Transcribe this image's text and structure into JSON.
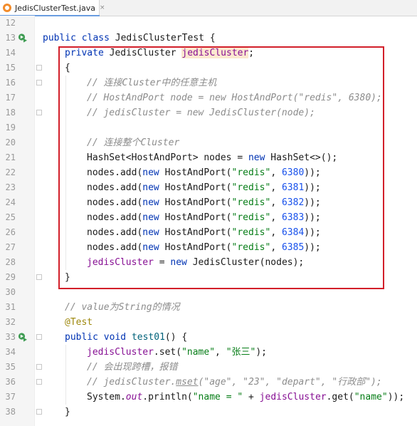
{
  "tab": {
    "title": "JedisClusterTest.java",
    "close": "×"
  },
  "lines": [
    {
      "n": "12",
      "segs": []
    },
    {
      "n": "13",
      "run": true,
      "segs": [
        {
          "t": "public ",
          "c": "kw"
        },
        {
          "t": "class ",
          "c": "kw"
        },
        {
          "t": "JedisClusterTest {",
          "c": ""
        }
      ]
    },
    {
      "n": "14",
      "indent": 1,
      "segs": [
        {
          "t": "private ",
          "c": "kw"
        },
        {
          "t": "JedisCluster ",
          "c": ""
        },
        {
          "t": "jedisCluster",
          "c": "fld hl"
        },
        {
          "t": ";",
          "c": ""
        }
      ]
    },
    {
      "n": "15",
      "indent": 1,
      "fold": true,
      "segs": [
        {
          "t": "{",
          "c": ""
        }
      ]
    },
    {
      "n": "16",
      "indent": 2,
      "fold": true,
      "segs": [
        {
          "t": "// 连接Cluster中的任意主机",
          "c": "cmt"
        }
      ]
    },
    {
      "n": "17",
      "indent": 2,
      "segs": [
        {
          "t": "// HostAndPort node = new HostAndPort(\"redis\", 6380);",
          "c": "cmt"
        }
      ]
    },
    {
      "n": "18",
      "indent": 2,
      "fold": true,
      "segs": [
        {
          "t": "// jedisCluster = new JedisCluster(node);",
          "c": "cmt"
        }
      ]
    },
    {
      "n": "19",
      "segs": []
    },
    {
      "n": "20",
      "indent": 2,
      "segs": [
        {
          "t": "// 连接整个Cluster",
          "c": "cmt"
        }
      ]
    },
    {
      "n": "21",
      "indent": 2,
      "segs": [
        {
          "t": "HashSet<HostAndPort> nodes = ",
          "c": ""
        },
        {
          "t": "new ",
          "c": "kw"
        },
        {
          "t": "HashSet<>();",
          "c": ""
        }
      ]
    },
    {
      "n": "22",
      "indent": 2,
      "segs": [
        {
          "t": "nodes.add(",
          "c": ""
        },
        {
          "t": "new ",
          "c": "kw"
        },
        {
          "t": "HostAndPort(",
          "c": ""
        },
        {
          "t": "\"redis\"",
          "c": "str"
        },
        {
          "t": ", ",
          "c": ""
        },
        {
          "t": "6380",
          "c": "num"
        },
        {
          "t": "));",
          "c": ""
        }
      ]
    },
    {
      "n": "23",
      "indent": 2,
      "segs": [
        {
          "t": "nodes.add(",
          "c": ""
        },
        {
          "t": "new ",
          "c": "kw"
        },
        {
          "t": "HostAndPort(",
          "c": ""
        },
        {
          "t": "\"redis\"",
          "c": "str"
        },
        {
          "t": ", ",
          "c": ""
        },
        {
          "t": "6381",
          "c": "num"
        },
        {
          "t": "));",
          "c": ""
        }
      ]
    },
    {
      "n": "24",
      "indent": 2,
      "segs": [
        {
          "t": "nodes.add(",
          "c": ""
        },
        {
          "t": "new ",
          "c": "kw"
        },
        {
          "t": "HostAndPort(",
          "c": ""
        },
        {
          "t": "\"redis\"",
          "c": "str"
        },
        {
          "t": ", ",
          "c": ""
        },
        {
          "t": "6382",
          "c": "num"
        },
        {
          "t": "));",
          "c": ""
        }
      ]
    },
    {
      "n": "25",
      "indent": 2,
      "segs": [
        {
          "t": "nodes.add(",
          "c": ""
        },
        {
          "t": "new ",
          "c": "kw"
        },
        {
          "t": "HostAndPort(",
          "c": ""
        },
        {
          "t": "\"redis\"",
          "c": "str"
        },
        {
          "t": ", ",
          "c": ""
        },
        {
          "t": "6383",
          "c": "num"
        },
        {
          "t": "));",
          "c": ""
        }
      ]
    },
    {
      "n": "26",
      "indent": 2,
      "segs": [
        {
          "t": "nodes.add(",
          "c": ""
        },
        {
          "t": "new ",
          "c": "kw"
        },
        {
          "t": "HostAndPort(",
          "c": ""
        },
        {
          "t": "\"redis\"",
          "c": "str"
        },
        {
          "t": ", ",
          "c": ""
        },
        {
          "t": "6384",
          "c": "num"
        },
        {
          "t": "));",
          "c": ""
        }
      ]
    },
    {
      "n": "27",
      "indent": 2,
      "segs": [
        {
          "t": "nodes.add(",
          "c": ""
        },
        {
          "t": "new ",
          "c": "kw"
        },
        {
          "t": "HostAndPort(",
          "c": ""
        },
        {
          "t": "\"redis\"",
          "c": "str"
        },
        {
          "t": ", ",
          "c": ""
        },
        {
          "t": "6385",
          "c": "num"
        },
        {
          "t": "));",
          "c": ""
        }
      ]
    },
    {
      "n": "28",
      "indent": 2,
      "segs": [
        {
          "t": "jedisCluster",
          "c": "fld"
        },
        {
          "t": " = ",
          "c": ""
        },
        {
          "t": "new ",
          "c": "kw"
        },
        {
          "t": "JedisCluster(nodes);",
          "c": ""
        }
      ]
    },
    {
      "n": "29",
      "indent": 1,
      "fold": true,
      "segs": [
        {
          "t": "}",
          "c": ""
        }
      ]
    },
    {
      "n": "30",
      "segs": []
    },
    {
      "n": "31",
      "indent": 1,
      "segs": [
        {
          "t": "// value为String的情况",
          "c": "cmt"
        }
      ]
    },
    {
      "n": "32",
      "indent": 1,
      "segs": [
        {
          "t": "@Test",
          "c": "ann"
        }
      ]
    },
    {
      "n": "33",
      "indent": 1,
      "run": true,
      "fold": true,
      "segs": [
        {
          "t": "public ",
          "c": "kw"
        },
        {
          "t": "void ",
          "c": "kw"
        },
        {
          "t": "test01",
          "c": "fn"
        },
        {
          "t": "() {",
          "c": ""
        }
      ]
    },
    {
      "n": "34",
      "indent": 2,
      "segs": [
        {
          "t": "jedisCluster",
          "c": "fld"
        },
        {
          "t": ".set(",
          "c": ""
        },
        {
          "t": "\"name\"",
          "c": "str"
        },
        {
          "t": ", ",
          "c": ""
        },
        {
          "t": "\"张三\"",
          "c": "str"
        },
        {
          "t": ");",
          "c": ""
        }
      ]
    },
    {
      "n": "35",
      "indent": 2,
      "fold": true,
      "segs": [
        {
          "t": "// 会出现跨槽，报错",
          "c": "cmt"
        }
      ]
    },
    {
      "n": "36",
      "indent": 2,
      "fold": true,
      "segs": [
        {
          "t": "// jedisCluster.",
          "c": "cmt"
        },
        {
          "t": "mset",
          "c": "cmt uline"
        },
        {
          "t": "(\"age\", \"23\", \"depart\", \"行政部\");",
          "c": "cmt"
        }
      ]
    },
    {
      "n": "37",
      "indent": 2,
      "segs": [
        {
          "t": "System.",
          "c": ""
        },
        {
          "t": "out",
          "c": "fld itl"
        },
        {
          "t": ".println(",
          "c": ""
        },
        {
          "t": "\"name = \"",
          "c": "str"
        },
        {
          "t": " + ",
          "c": ""
        },
        {
          "t": "jedisCluster",
          "c": "fld"
        },
        {
          "t": ".get(",
          "c": ""
        },
        {
          "t": "\"name\"",
          "c": "str"
        },
        {
          "t": "));",
          "c": ""
        }
      ]
    },
    {
      "n": "38",
      "indent": 1,
      "fold": true,
      "segs": [
        {
          "t": "}",
          "c": ""
        }
      ]
    }
  ]
}
